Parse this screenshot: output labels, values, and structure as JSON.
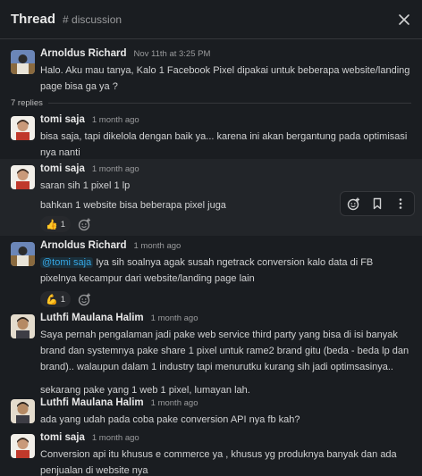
{
  "header": {
    "title": "Thread",
    "channel": "# discussion"
  },
  "parent": {
    "author": "Arnoldus Richard",
    "time": "Nov 11th at 3:25 PM",
    "text": "Halo. Aku mau tanya, Kalo 1 Facebook Pixel dipakai untuk beberapa website/landing page bisa ga ya ?"
  },
  "replies_label": "7 replies",
  "messages": [
    {
      "author": "tomi saja",
      "time": "1 month ago",
      "text": "bisa saja, tapi dikelola dengan baik ya... karena ini akan bergantung pada optimisasi nya nanti"
    },
    {
      "author": "tomi saja",
      "time": "1 month ago",
      "text": "saran sih 1 pixel 1 lp",
      "text2": "bahkan 1 website bisa beberapa pixel juga",
      "reaction": {
        "emoji": "👍",
        "count": "1"
      }
    },
    {
      "author": "Arnoldus Richard",
      "time": "1 month ago",
      "mention": "@tomi saja",
      "text": " Iya sih soalnya agak susah ngetrack conversion kalo data di FB pixelnya kecampur dari website/landing page lain",
      "reaction": {
        "emoji": "💪",
        "count": "1"
      }
    },
    {
      "author": "Luthfi Maulana Halim",
      "time": "1 month ago",
      "text": "Saya pernah pengalaman jadi pake web service third party yang bisa di isi banyak brand dan systemnya pake share 1 pixel untuk rame2 brand gitu (beda - beda lp dan brand).. walaupun dalam 1 industry tapi menurutku kurang sih jadi optimsasinya..",
      "text2": "sekarang pake yang 1 web 1 pixel, lumayan lah."
    },
    {
      "author": "Luthfi Maulana Halim",
      "time": "1 month ago",
      "text": "ada yang udah pada coba pake conversion API nya fb kah?"
    },
    {
      "author": "tomi saja",
      "time": "1 month ago",
      "text": "Conversion api itu khusus e commerce ya , khusus yg produknya banyak dan ada penjualan di website nya"
    }
  ],
  "colors": {
    "background": "#1a1d21",
    "text": "#d1d2d3",
    "mention": "#36a8e6",
    "border": "#35373b"
  }
}
